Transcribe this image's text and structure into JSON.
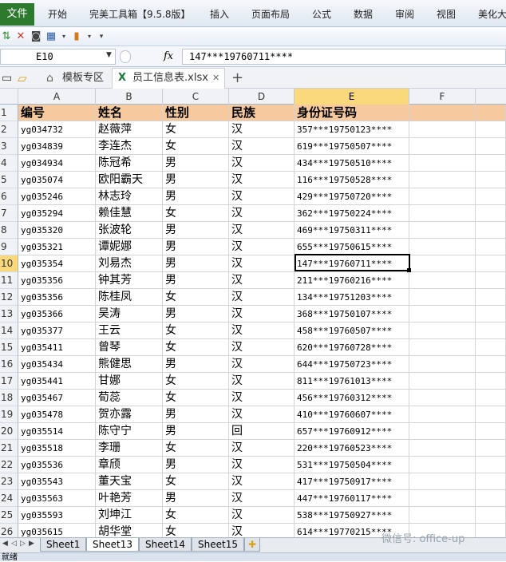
{
  "ribbon": {
    "file": "文件",
    "tabs": [
      "开始",
      "完美工具箱【9.5.8版】",
      "插入",
      "页面布局",
      "公式",
      "数据",
      "审阅",
      "视图",
      "美化大"
    ]
  },
  "formula_bar": {
    "name_box": "E10",
    "fx": "fx",
    "value": "147***19760711****"
  },
  "doc_tabs": {
    "template": "模板专区",
    "file": "员工信息表.xlsx",
    "add": "+"
  },
  "columns": [
    "A",
    "B",
    "C",
    "D",
    "E",
    "F"
  ],
  "header_row": {
    "num": "1",
    "cells": [
      "编号",
      "姓名",
      "性别",
      "民族",
      "身份证号码"
    ]
  },
  "rows": [
    {
      "num": "2",
      "cells": [
        "yg034732",
        "赵薇萍",
        "女",
        "汉",
        "357***19750123****"
      ]
    },
    {
      "num": "3",
      "cells": [
        "yg034839",
        "李连杰",
        "女",
        "汉",
        "619***19750507****"
      ]
    },
    {
      "num": "4",
      "cells": [
        "yg034934",
        "陈冠希",
        "男",
        "汉",
        "434***19750510****"
      ]
    },
    {
      "num": "5",
      "cells": [
        "yg035074",
        "欧阳霸天",
        "男",
        "汉",
        "116***19750528****"
      ]
    },
    {
      "num": "6",
      "cells": [
        "yg035246",
        "林志玲",
        "男",
        "汉",
        "429***19750720****"
      ]
    },
    {
      "num": "7",
      "cells": [
        "yg035294",
        "赖佳慧",
        "女",
        "汉",
        "362***19750224****"
      ]
    },
    {
      "num": "8",
      "cells": [
        "yg035320",
        "张波轮",
        "男",
        "汉",
        "469***19750311****"
      ]
    },
    {
      "num": "9",
      "cells": [
        "yg035321",
        "谭妮娜",
        "男",
        "汉",
        "655***19750615****"
      ]
    },
    {
      "num": "10",
      "cells": [
        "yg035354",
        "刘易杰",
        "男",
        "汉",
        "147***19760711****"
      ]
    },
    {
      "num": "11",
      "cells": [
        "yg035356",
        "钟其芳",
        "男",
        "汉",
        "211***19760216****"
      ]
    },
    {
      "num": "12",
      "cells": [
        "yg035356",
        "陈桂凤",
        "女",
        "汉",
        "134***19751203****"
      ]
    },
    {
      "num": "13",
      "cells": [
        "yg035366",
        "吴涛",
        "男",
        "汉",
        "368***19750107****"
      ]
    },
    {
      "num": "14",
      "cells": [
        "yg035377",
        "王云",
        "女",
        "汉",
        "458***19760507****"
      ]
    },
    {
      "num": "15",
      "cells": [
        "yg035411",
        "曾琴",
        "女",
        "汉",
        "620***19760728****"
      ]
    },
    {
      "num": "16",
      "cells": [
        "yg035434",
        "熊健思",
        "男",
        "汉",
        "644***19750723****"
      ]
    },
    {
      "num": "17",
      "cells": [
        "yg035441",
        "甘娜",
        "女",
        "汉",
        "811***19761013****"
      ]
    },
    {
      "num": "18",
      "cells": [
        "yg035467",
        "荀蕊",
        "女",
        "汉",
        "456***19760312****"
      ]
    },
    {
      "num": "19",
      "cells": [
        "yg035478",
        "贺亦露",
        "男",
        "汉",
        "410***19760607****"
      ]
    },
    {
      "num": "20",
      "cells": [
        "yg035514",
        "陈守宁",
        "男",
        "回",
        "657***19760912****"
      ]
    },
    {
      "num": "21",
      "cells": [
        "yg035518",
        "李珊",
        "女",
        "汉",
        "220***19760523****"
      ]
    },
    {
      "num": "22",
      "cells": [
        "yg035536",
        "章颀",
        "男",
        "汉",
        "531***19750504****"
      ]
    },
    {
      "num": "23",
      "cells": [
        "yg035543",
        "董天宝",
        "女",
        "汉",
        "417***19750917****"
      ]
    },
    {
      "num": "24",
      "cells": [
        "yg035563",
        "叶艳芳",
        "男",
        "汉",
        "447***19760117****"
      ]
    },
    {
      "num": "25",
      "cells": [
        "yg035593",
        "刘坤江",
        "女",
        "汉",
        "538***19750927****"
      ]
    },
    {
      "num": "26",
      "cells": [
        "yg035615",
        "胡华堂",
        "女",
        "汉",
        "614***19770215****"
      ]
    }
  ],
  "sheets": [
    "Sheet1",
    "Sheet13",
    "Sheet14",
    "Sheet15"
  ],
  "active_sheet": "Sheet13",
  "status": "就绪",
  "watermark": "微信号: office-up"
}
